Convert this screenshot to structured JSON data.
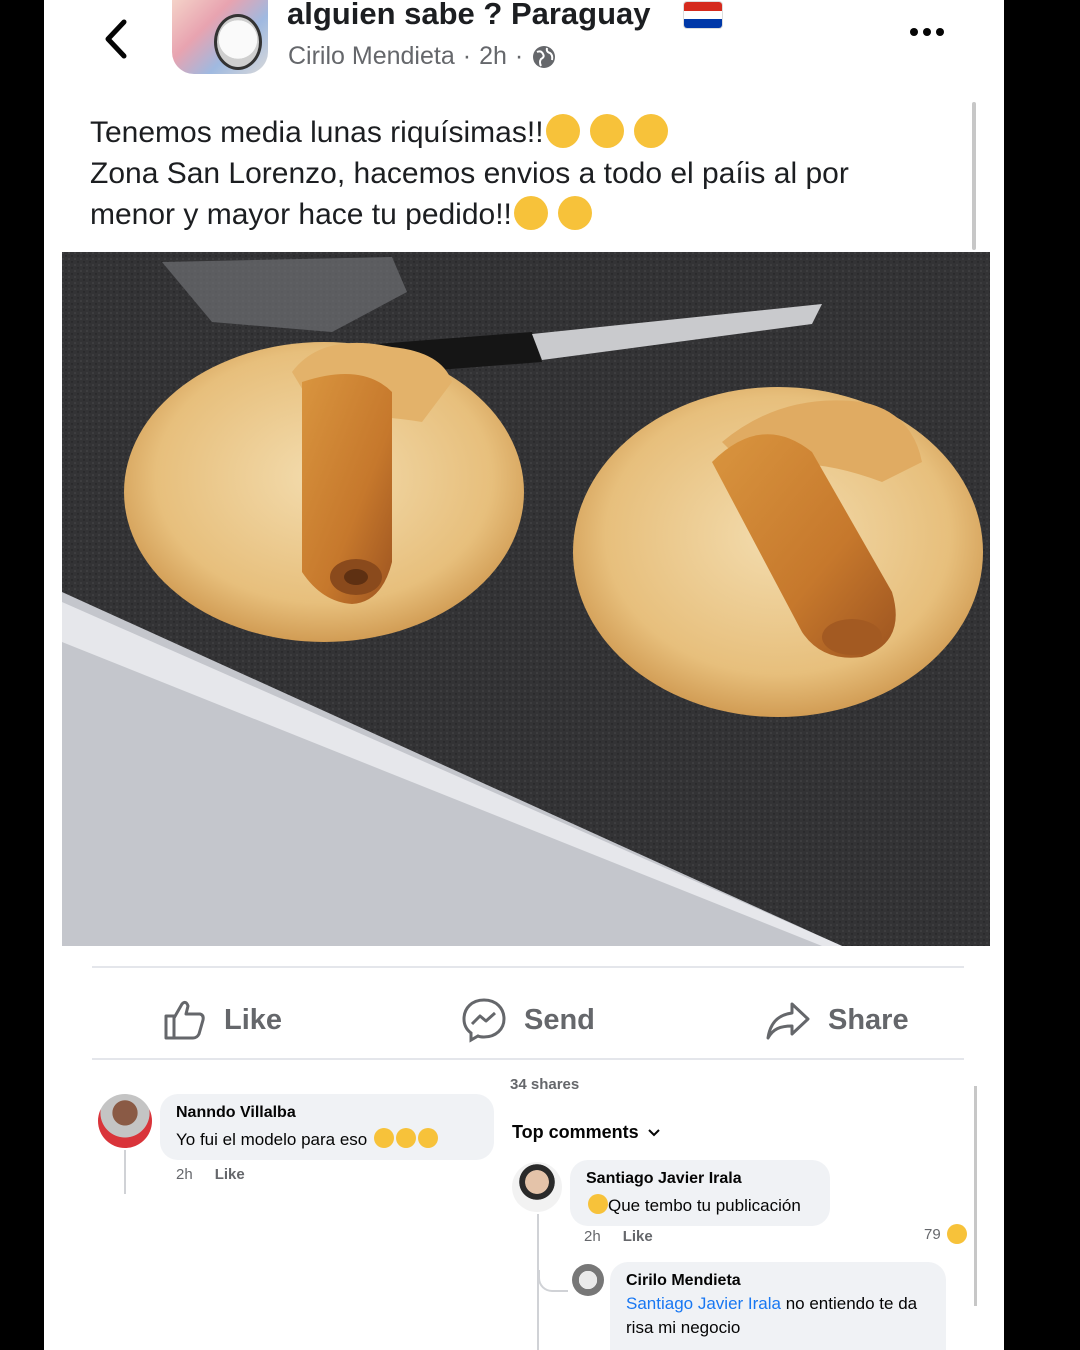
{
  "header": {
    "group_name": "alguien sabe ? Paraguay",
    "author": "Cirilo Mendieta",
    "time": "2h"
  },
  "post": {
    "line1": "Tenemos media lunas riquísimas!!",
    "line2": "Zona San Lorenzo, hacemos envios a todo el paíis al por",
    "line3": "menor y mayor hace tu pedido!!"
  },
  "actions": {
    "like": "Like",
    "send": "Send",
    "share": "Share"
  },
  "left_comment": {
    "name": "Nanndo Villalba",
    "text": "Yo fui el modelo para eso",
    "time": "2h",
    "like": "Like"
  },
  "right_panel": {
    "shares": "34 shares",
    "sort": "Top comments",
    "comment": {
      "name": "Santiago Javier Irala",
      "text": "Que tembo tu publicación",
      "time": "2h",
      "like": "Like",
      "reaction_count": "79"
    },
    "reply": {
      "name": "Cirilo Mendieta",
      "mention": "Santiago Javier Irala",
      "text_after": " no entiendo te da",
      "text_line2": "risa mi negocio"
    }
  },
  "colors": {
    "link": "#1877f2",
    "secondary_text": "#65676b",
    "bubble": "#f0f2f5"
  }
}
